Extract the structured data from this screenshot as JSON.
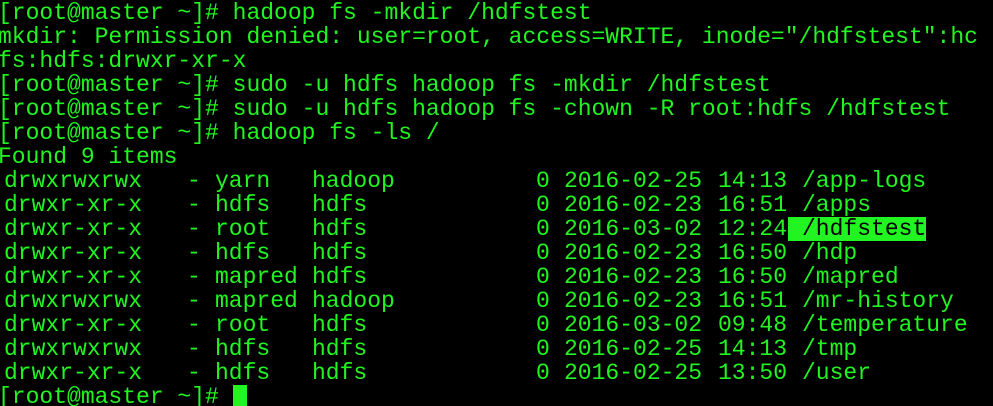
{
  "terminal": {
    "colors": {
      "background": "#000000",
      "foreground": "#22f422",
      "highlight_bg": "#22f422",
      "highlight_fg": "#000000"
    },
    "lines": [
      "[root@master ~]# hadoop fs -mkdir /hdfstest",
      "mkdir: Permission denied: user=root, access=WRITE, inode=\"/hdfstest\":hc",
      "fs:hdfs:drwxr-xr-x",
      "[root@master ~]# sudo -u hdfs hadoop fs -mkdir /hdfstest",
      "[root@master ~]# sudo -u hdfs hadoop fs -chown -R root:hdfs /hdfstest",
      "[root@master ~]# hadoop fs -ls /",
      "Found 9 items"
    ],
    "listing": [
      {
        "perm": "drwxrwxrwx",
        "dash": "-",
        "owner": "yarn",
        "group": "hadoop",
        "size": "0",
        "date": "2016-02-25",
        "time": "14:13",
        "path": "/app-logs"
      },
      {
        "perm": "drwxr-xr-x",
        "dash": "-",
        "owner": "hdfs",
        "group": "hdfs",
        "size": "0",
        "date": "2016-02-23",
        "time": "16:51",
        "path": "/apps"
      },
      {
        "perm": "drwxr-xr-x",
        "dash": "-",
        "owner": "root",
        "group": "hdfs",
        "size": "0",
        "date": "2016-03-02",
        "time": "12:24",
        "path": "/hdfstest"
      },
      {
        "perm": "drwxr-xr-x",
        "dash": "-",
        "owner": "hdfs",
        "group": "hdfs",
        "size": "0",
        "date": "2016-02-23",
        "time": "16:50",
        "path": "/hdp"
      },
      {
        "perm": "drwxr-xr-x",
        "dash": "-",
        "owner": "mapred",
        "group": "hdfs",
        "size": "0",
        "date": "2016-02-23",
        "time": "16:50",
        "path": "/mapred"
      },
      {
        "perm": "drwxrwxrwx",
        "dash": "-",
        "owner": "mapred",
        "group": "hadoop",
        "size": "0",
        "date": "2016-02-23",
        "time": "16:51",
        "path": "/mr-history"
      },
      {
        "perm": "drwxr-xr-x",
        "dash": "-",
        "owner": "root",
        "group": "hdfs",
        "size": "0",
        "date": "2016-03-02",
        "time": "09:48",
        "path": "/temperature"
      },
      {
        "perm": "drwxrwxrwx",
        "dash": "-",
        "owner": "hdfs",
        "group": "hdfs",
        "size": "0",
        "date": "2016-02-25",
        "time": "14:13",
        "path": "/tmp"
      },
      {
        "perm": "drwxr-xr-x",
        "dash": "-",
        "owner": "hdfs",
        "group": "hdfs",
        "size": "0",
        "date": "2016-02-25",
        "time": "13:50",
        "path": "/user"
      }
    ],
    "prompt": "[root@master ~]#"
  }
}
